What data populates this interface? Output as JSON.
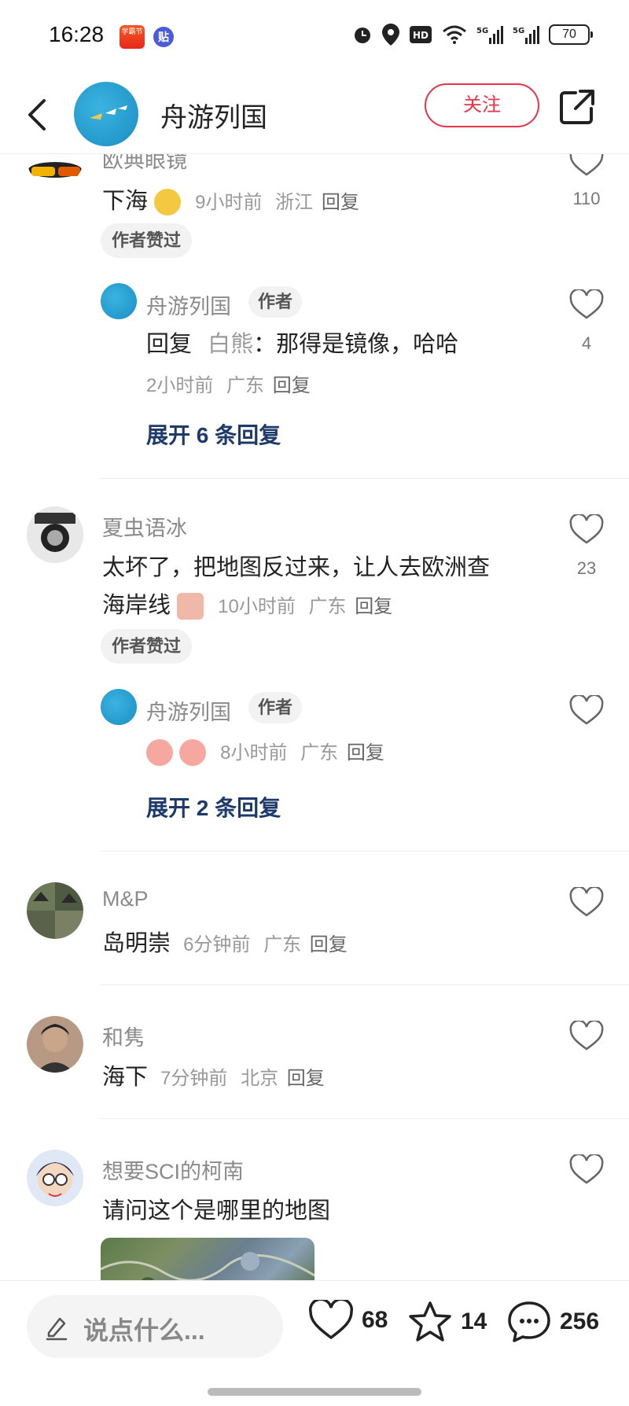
{
  "status_bar": {
    "time": "16:28",
    "app1": "学霸节",
    "app2": "贴",
    "battery": "70"
  },
  "header": {
    "title": "舟游列国",
    "follow_label": "关注"
  },
  "comments": [
    {
      "name": "欧典眼镜",
      "text": "下海",
      "time": "9小时前",
      "location": "浙江",
      "reply": "回复",
      "likes": "110",
      "badge": "作者赞过",
      "sub": {
        "name": "舟游列国",
        "author_tag": "作者",
        "prefix": "回复",
        "target": "白熊",
        "text": "：那得是镜像，哈哈",
        "time": "2小时前",
        "location": "广东",
        "reply": "回复",
        "likes": "4"
      },
      "expand": "展开 6 条回复"
    },
    {
      "name": "夏虫语冰",
      "text_line1": "太坏了，把地图反过来，让人去欧洲查",
      "text_line2": "海岸线",
      "time": "10小时前",
      "location": "广东",
      "reply": "回复",
      "likes": "23",
      "badge": "作者赞过",
      "sub": {
        "name": "舟游列国",
        "author_tag": "作者",
        "time": "8小时前",
        "location": "广东",
        "reply": "回复"
      },
      "expand": "展开 2 条回复"
    },
    {
      "name": "M&P",
      "text": "岛明崇",
      "time": "6分钟前",
      "location": "广东",
      "reply": "回复"
    },
    {
      "name": "和隽",
      "text": "海下",
      "time": "7分钟前",
      "location": "北京",
      "reply": "回复"
    },
    {
      "name": "想要SCI的柯南",
      "text": "请问这个是哪里的地图"
    }
  ],
  "bottom_bar": {
    "placeholder": "说点什么...",
    "likes": "68",
    "favorites": "14",
    "comments": "256"
  },
  "colors": {
    "accent": "#e8344b",
    "link": "#1e3a6b"
  }
}
